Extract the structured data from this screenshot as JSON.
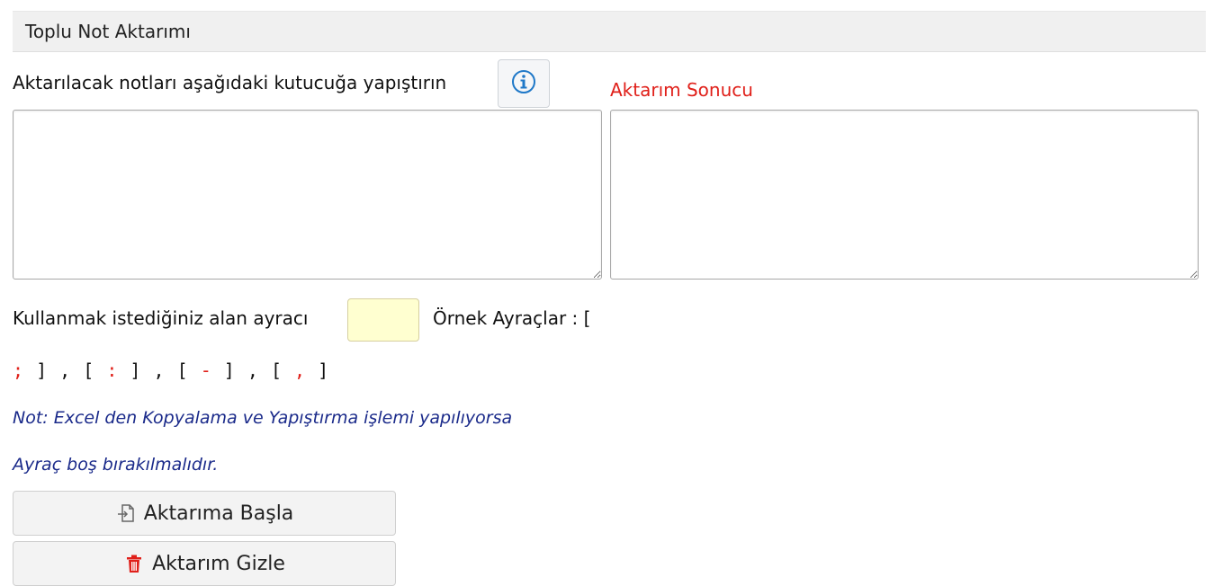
{
  "panel": {
    "title": "Toplu Not Aktarımı"
  },
  "import": {
    "label": "Aktarılacak notları aşağıdaki kutucuğa yapıştırın",
    "info_icon": "info-circle-icon",
    "value": ""
  },
  "result": {
    "label": "Aktarım Sonucu",
    "value": ""
  },
  "separator": {
    "label": "Kullanmak istediğiniz alan ayracı",
    "value": "",
    "examples_label": "Örnek Ayraçlar : [",
    "examples": [
      ";",
      ":",
      "-",
      ","
    ]
  },
  "notes": {
    "line1": "Not: Excel den Kopyalama ve Yapıştırma işlemi yapılıyorsa",
    "line2": "Ayraç boş bırakılmalıdır."
  },
  "buttons": {
    "start_label": "Aktarıma Başla",
    "start_icon": "import-icon",
    "hide_label": "Aktarım Gizle",
    "hide_icon": "trash-icon"
  },
  "colors": {
    "accent_red": "#e0201a",
    "note_blue": "#1a2a8a",
    "info_blue": "#1f78c8",
    "separator_input_bg": "#ffffd0"
  }
}
